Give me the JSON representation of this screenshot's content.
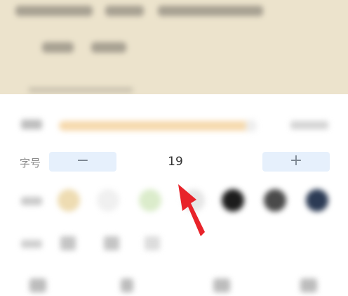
{
  "font_size": {
    "label": "字号",
    "value": "19",
    "decrease_symbol": "−",
    "increase_symbol": "+"
  },
  "background_swatches": [
    {
      "name": "beige",
      "color": "#eedcb2"
    },
    {
      "name": "light-gray",
      "color": "#f0f0f0"
    },
    {
      "name": "light-green",
      "color": "#dbeccb"
    },
    {
      "name": "pale-gray",
      "color": "#e6e6e6"
    },
    {
      "name": "black",
      "color": "#1c1c1c"
    },
    {
      "name": "dark-gray",
      "color": "#4a4a4a"
    },
    {
      "name": "navy",
      "color": "#2c3b55"
    }
  ],
  "colors": {
    "accent_blue_light": "#e6f0fc",
    "brightness_track": "#f6d9ad",
    "reader_background": "#ece3cc",
    "annotation_arrow": "#e8232a"
  },
  "icons": {
    "decrease": "minus-icon",
    "increase": "plus-icon",
    "annotation": "red-arrow-icon"
  }
}
